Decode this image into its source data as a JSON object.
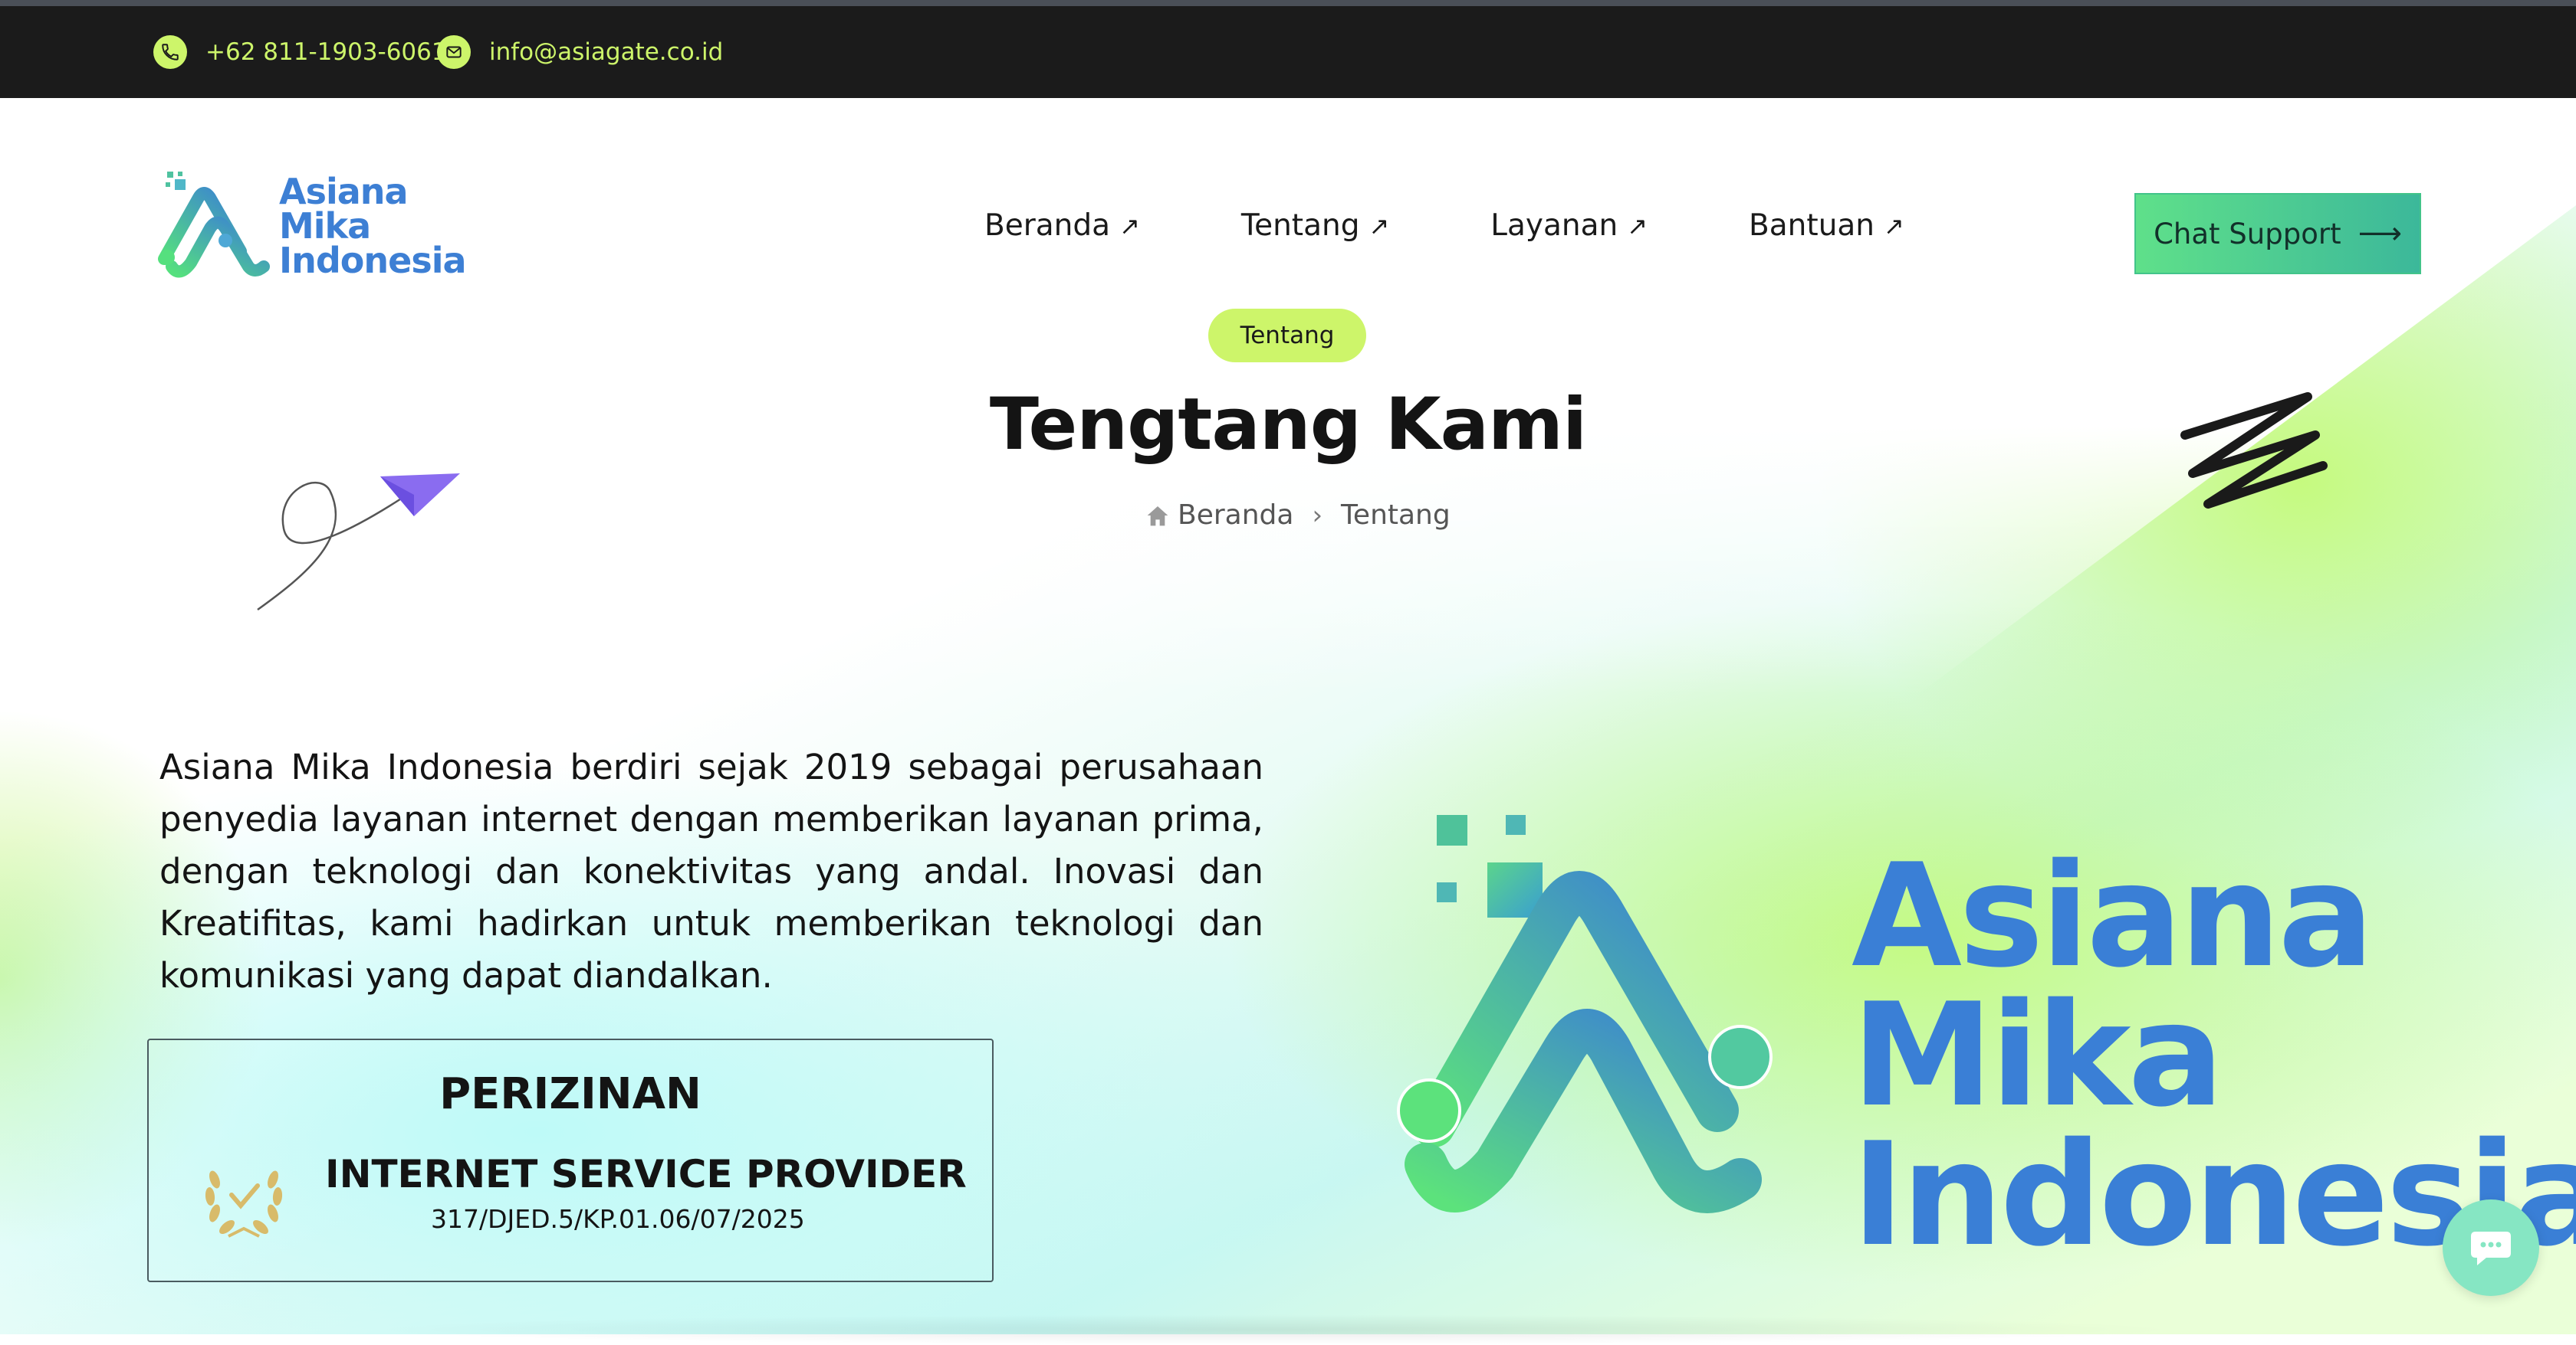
{
  "topbar": {
    "phone": "+62 811-1903-6061",
    "email": "info@asiagate.co.id",
    "phone_icon": "phone-icon",
    "email_icon": "mail-icon"
  },
  "header": {
    "logo": {
      "line1": "Asiana",
      "line2": "Mika",
      "line3": "Indonesia"
    },
    "nav": [
      {
        "label": "Beranda",
        "icon": "arrow-up-right-icon"
      },
      {
        "label": "Tentang",
        "icon": "arrow-up-right-icon"
      },
      {
        "label": "Layanan",
        "icon": "arrow-up-right-icon"
      },
      {
        "label": "Bantuan",
        "icon": "arrow-up-right-icon"
      }
    ],
    "chat_button": {
      "label": "Chat Support",
      "icon": "long-arrow-right-icon"
    }
  },
  "hero": {
    "pill": "Tentang",
    "title": "Tengtang Kami",
    "breadcrumb": {
      "home": "Beranda",
      "current": "Tentang"
    }
  },
  "about": {
    "paragraph": "Asiana Mika Indonesia berdiri sejak 2019 sebagai perusahaan penyedia layanan internet dengan memberikan layanan prima, dengan teknologi dan konektivitas yang andal. Inovasi dan Kreatifitas, kami hadirkan untuk memberikan teknologi dan komunikasi yang dapat diandalkan.",
    "license": {
      "title": "PERIZINAN",
      "name": "INTERNET SERVICE PROVIDER",
      "number": "317/DJED.5/KP.01.06/07/2025"
    }
  },
  "big_logo": {
    "line1": "Asiana",
    "line2": "Mika",
    "line3": "Indonesia"
  },
  "colors": {
    "topbar_bg": "#1b1b1b",
    "accent_lime": "#cdf56a",
    "brand_blue": "#3a7fd6",
    "brand_green": "#5fe08a",
    "chat_fab": "#86e6c3"
  }
}
